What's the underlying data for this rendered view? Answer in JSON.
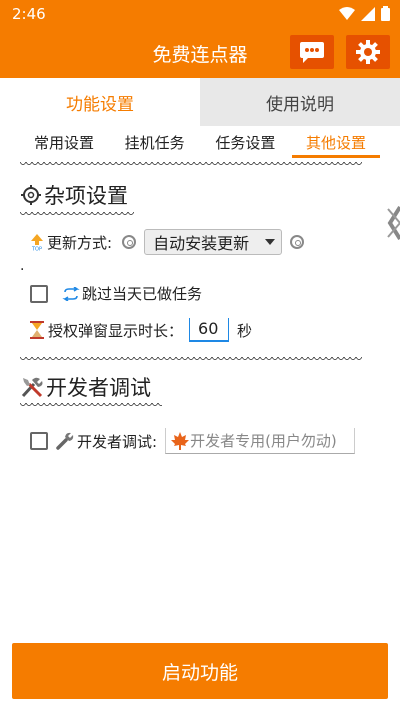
{
  "status": {
    "time": "2:46"
  },
  "appbar": {
    "title": "免费连点器",
    "chat_icon": "chat-bubble-icon",
    "settings_icon": "gear-icon"
  },
  "tabs": [
    {
      "label": "功能设置",
      "active": true
    },
    {
      "label": "使用说明",
      "active": false
    }
  ],
  "subtabs": [
    {
      "label": "常用设置"
    },
    {
      "label": "挂机任务"
    },
    {
      "label": "任务设置"
    },
    {
      "label": "其他设置",
      "active": true
    }
  ],
  "misc": {
    "title": "杂项设置",
    "update_label": "更新方式:",
    "update_value": "自动安装更新",
    "dot": ".",
    "skip_label": "跳过当天已做任务",
    "auth_label": "授权弹窗显示时长：",
    "auth_value": "60",
    "auth_unit": "秒"
  },
  "dev": {
    "title": "开发者调试",
    "label": "开发者调试:",
    "placeholder": "开发者专用(用户勿动)"
  },
  "start_button": "启动功能",
  "colors": {
    "accent": "#f57c00",
    "accent_dark": "#e65100"
  }
}
